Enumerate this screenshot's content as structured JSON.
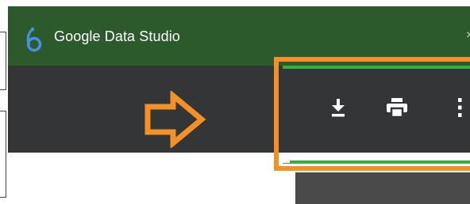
{
  "window": {
    "title": "Google Data Studio",
    "close_glyph": "×"
  },
  "toolbar": {
    "actions": [
      {
        "name": "download",
        "icon": "download-icon"
      },
      {
        "name": "print",
        "icon": "print-icon"
      },
      {
        "name": "more",
        "icon": "more-vert-icon"
      }
    ]
  },
  "annotations": {
    "arrow_color": "#f39026",
    "highlight_color": "#f39026"
  },
  "colors": {
    "titlebar": "#2d5a2c",
    "toolbar": "#333537",
    "progress": "#2fb33a",
    "accent": "#f39026"
  }
}
